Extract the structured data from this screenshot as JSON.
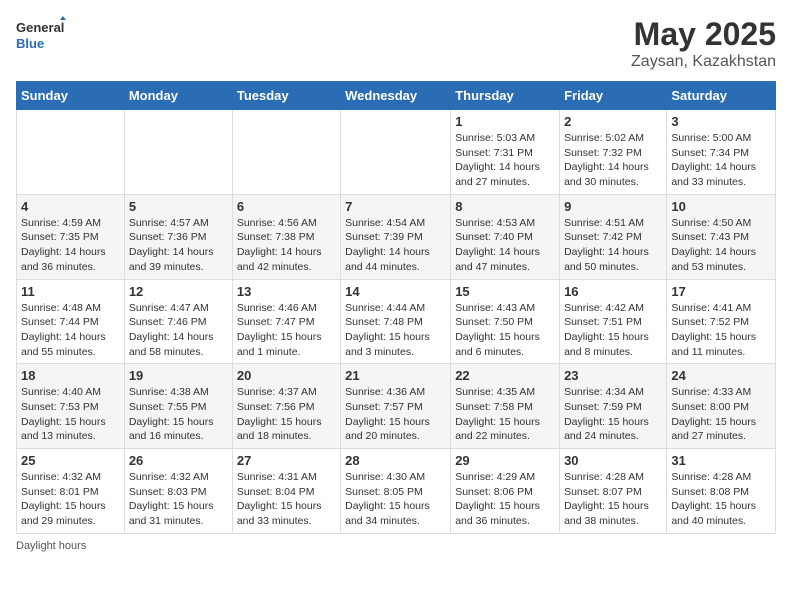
{
  "logo": {
    "general": "General",
    "blue": "Blue"
  },
  "title": "May 2025",
  "subtitle": "Zaysan, Kazakhstan",
  "days_header": [
    "Sunday",
    "Monday",
    "Tuesday",
    "Wednesday",
    "Thursday",
    "Friday",
    "Saturday"
  ],
  "footer_note": "Daylight hours",
  "weeks": [
    [
      {
        "day": "",
        "info": ""
      },
      {
        "day": "",
        "info": ""
      },
      {
        "day": "",
        "info": ""
      },
      {
        "day": "",
        "info": ""
      },
      {
        "day": "1",
        "info": "Sunrise: 5:03 AM\nSunset: 7:31 PM\nDaylight: 14 hours and 27 minutes."
      },
      {
        "day": "2",
        "info": "Sunrise: 5:02 AM\nSunset: 7:32 PM\nDaylight: 14 hours and 30 minutes."
      },
      {
        "day": "3",
        "info": "Sunrise: 5:00 AM\nSunset: 7:34 PM\nDaylight: 14 hours and 33 minutes."
      }
    ],
    [
      {
        "day": "4",
        "info": "Sunrise: 4:59 AM\nSunset: 7:35 PM\nDaylight: 14 hours and 36 minutes."
      },
      {
        "day": "5",
        "info": "Sunrise: 4:57 AM\nSunset: 7:36 PM\nDaylight: 14 hours and 39 minutes."
      },
      {
        "day": "6",
        "info": "Sunrise: 4:56 AM\nSunset: 7:38 PM\nDaylight: 14 hours and 42 minutes."
      },
      {
        "day": "7",
        "info": "Sunrise: 4:54 AM\nSunset: 7:39 PM\nDaylight: 14 hours and 44 minutes."
      },
      {
        "day": "8",
        "info": "Sunrise: 4:53 AM\nSunset: 7:40 PM\nDaylight: 14 hours and 47 minutes."
      },
      {
        "day": "9",
        "info": "Sunrise: 4:51 AM\nSunset: 7:42 PM\nDaylight: 14 hours and 50 minutes."
      },
      {
        "day": "10",
        "info": "Sunrise: 4:50 AM\nSunset: 7:43 PM\nDaylight: 14 hours and 53 minutes."
      }
    ],
    [
      {
        "day": "11",
        "info": "Sunrise: 4:48 AM\nSunset: 7:44 PM\nDaylight: 14 hours and 55 minutes."
      },
      {
        "day": "12",
        "info": "Sunrise: 4:47 AM\nSunset: 7:46 PM\nDaylight: 14 hours and 58 minutes."
      },
      {
        "day": "13",
        "info": "Sunrise: 4:46 AM\nSunset: 7:47 PM\nDaylight: 15 hours and 1 minute."
      },
      {
        "day": "14",
        "info": "Sunrise: 4:44 AM\nSunset: 7:48 PM\nDaylight: 15 hours and 3 minutes."
      },
      {
        "day": "15",
        "info": "Sunrise: 4:43 AM\nSunset: 7:50 PM\nDaylight: 15 hours and 6 minutes."
      },
      {
        "day": "16",
        "info": "Sunrise: 4:42 AM\nSunset: 7:51 PM\nDaylight: 15 hours and 8 minutes."
      },
      {
        "day": "17",
        "info": "Sunrise: 4:41 AM\nSunset: 7:52 PM\nDaylight: 15 hours and 11 minutes."
      }
    ],
    [
      {
        "day": "18",
        "info": "Sunrise: 4:40 AM\nSunset: 7:53 PM\nDaylight: 15 hours and 13 minutes."
      },
      {
        "day": "19",
        "info": "Sunrise: 4:38 AM\nSunset: 7:55 PM\nDaylight: 15 hours and 16 minutes."
      },
      {
        "day": "20",
        "info": "Sunrise: 4:37 AM\nSunset: 7:56 PM\nDaylight: 15 hours and 18 minutes."
      },
      {
        "day": "21",
        "info": "Sunrise: 4:36 AM\nSunset: 7:57 PM\nDaylight: 15 hours and 20 minutes."
      },
      {
        "day": "22",
        "info": "Sunrise: 4:35 AM\nSunset: 7:58 PM\nDaylight: 15 hours and 22 minutes."
      },
      {
        "day": "23",
        "info": "Sunrise: 4:34 AM\nSunset: 7:59 PM\nDaylight: 15 hours and 24 minutes."
      },
      {
        "day": "24",
        "info": "Sunrise: 4:33 AM\nSunset: 8:00 PM\nDaylight: 15 hours and 27 minutes."
      }
    ],
    [
      {
        "day": "25",
        "info": "Sunrise: 4:32 AM\nSunset: 8:01 PM\nDaylight: 15 hours and 29 minutes."
      },
      {
        "day": "26",
        "info": "Sunrise: 4:32 AM\nSunset: 8:03 PM\nDaylight: 15 hours and 31 minutes."
      },
      {
        "day": "27",
        "info": "Sunrise: 4:31 AM\nSunset: 8:04 PM\nDaylight: 15 hours and 33 minutes."
      },
      {
        "day": "28",
        "info": "Sunrise: 4:30 AM\nSunset: 8:05 PM\nDaylight: 15 hours and 34 minutes."
      },
      {
        "day": "29",
        "info": "Sunrise: 4:29 AM\nSunset: 8:06 PM\nDaylight: 15 hours and 36 minutes."
      },
      {
        "day": "30",
        "info": "Sunrise: 4:28 AM\nSunset: 8:07 PM\nDaylight: 15 hours and 38 minutes."
      },
      {
        "day": "31",
        "info": "Sunrise: 4:28 AM\nSunset: 8:08 PM\nDaylight: 15 hours and 40 minutes."
      }
    ]
  ]
}
